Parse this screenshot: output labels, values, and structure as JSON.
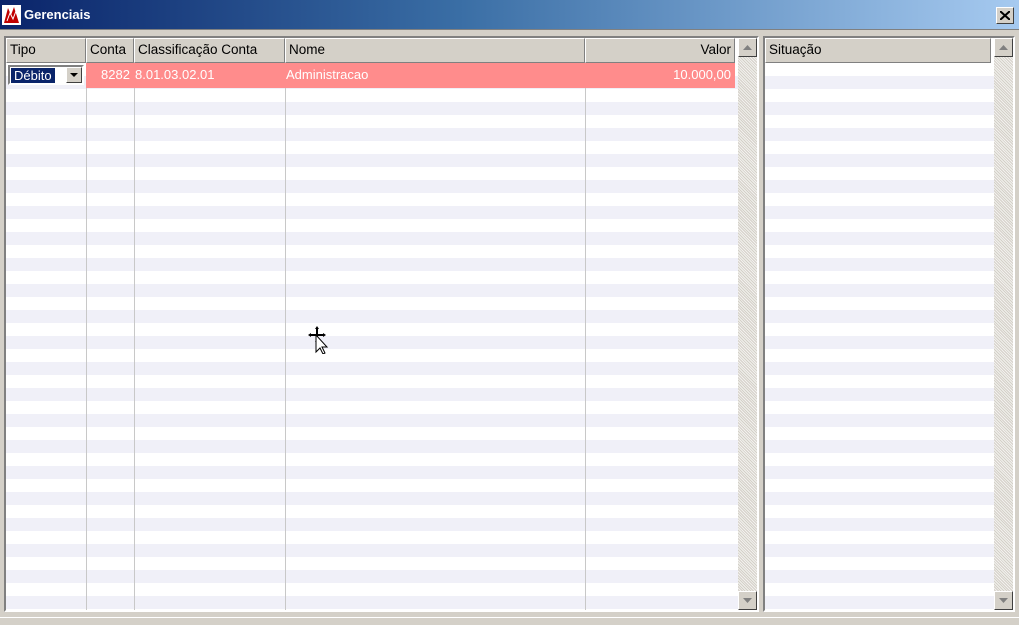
{
  "window": {
    "title": "Gerenciais",
    "close_label": "×"
  },
  "grid": {
    "columns": [
      {
        "key": "tipo",
        "label": "Tipo"
      },
      {
        "key": "conta",
        "label": "Conta"
      },
      {
        "key": "classificacao",
        "label": "Classificação Conta"
      },
      {
        "key": "nome",
        "label": "Nome"
      },
      {
        "key": "valor",
        "label": "Valor"
      }
    ],
    "rows": [
      {
        "tipo": "Débito",
        "conta": "8282",
        "classificacao": "8.01.03.02.01",
        "nome": "Administracao",
        "valor": "10.000,00"
      }
    ],
    "selected_row_color": "#ff8c8c"
  },
  "side_grid": {
    "columns": [
      {
        "key": "situacao",
        "label": "Situação"
      }
    ]
  },
  "colors": {
    "title_start": "#0a246a",
    "title_end": "#a6caf0",
    "row_alt": "#f0f0f8"
  }
}
